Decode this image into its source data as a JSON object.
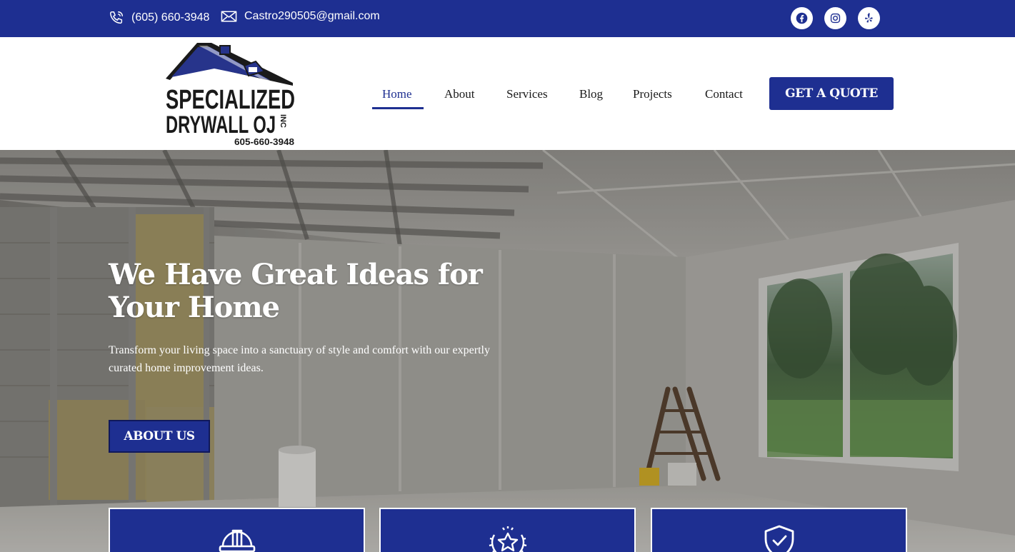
{
  "topbar": {
    "phone": "(605) 660-3948",
    "email": "Castro290505@gmail.com",
    "social": [
      {
        "icon": "facebook-icon"
      },
      {
        "icon": "instagram-icon"
      },
      {
        "icon": "yelp-icon"
      }
    ]
  },
  "logo": {
    "line1": "SPECIALIZED",
    "line2": "DRYWALL OJ",
    "suffix": "INC",
    "phone": "605-660-3948"
  },
  "nav": {
    "items": [
      "Home",
      "About",
      "Services",
      "Blog",
      "Projects",
      "Contact"
    ],
    "active": "Home",
    "cta": "GET A QUOTE"
  },
  "hero": {
    "title": "We Have Great Ideas for Your Home",
    "text": "Transform your living space into a sanctuary of style and comfort with our expertly curated home improvement ideas.",
    "button": "ABOUT US"
  },
  "features": [
    {
      "icon": "hard-hat-icon"
    },
    {
      "icon": "award-star-icon"
    },
    {
      "icon": "shield-check-icon"
    }
  ],
  "colors": {
    "brand": "#1e2f91",
    "white": "#ffffff",
    "text": "#1a1a1a"
  }
}
